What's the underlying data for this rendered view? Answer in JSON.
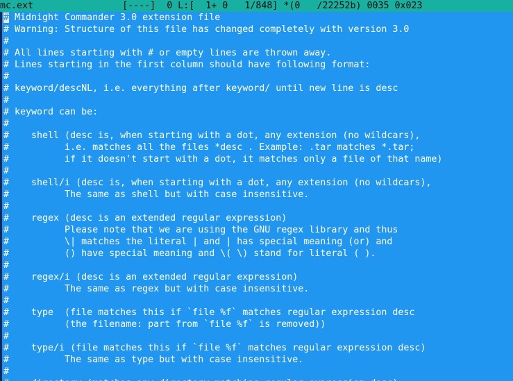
{
  "status": {
    "filename": "mc.ext",
    "flags": "[----]",
    "col": "0",
    "line_label": "L:[",
    "line_pos": "1+ 0",
    "line_count": "1/848]",
    "char_info": "*(0   /22252b)",
    "char_code": "0035 0x023"
  },
  "editor": {
    "cursor_char": "#",
    "first_line_rest": " Midnight Commander 3.0 extension file",
    "lines": [
      "# Warning: Structure of this file has changed completely with version 3.0",
      "#",
      "# All lines starting with # or empty lines are thrown away.",
      "# Lines starting in the first column should have following format:",
      "#",
      "# keyword/descNL, i.e. everything after keyword/ until new line is desc",
      "#",
      "# keyword can be:",
      "#",
      "#    shell (desc is, when starting with a dot, any extension (no wildcars),",
      "#          i.e. matches all the files *desc . Example: .tar matches *.tar;",
      "#          if it doesn't start with a dot, it matches only a file of that name)",
      "#",
      "#    shell/i (desc is, when starting with a dot, any extension (no wildcars),",
      "#          The same as shell but with case insensitive.",
      "#",
      "#    regex (desc is an extended regular expression)",
      "#          Please note that we are using the GNU regex library and thus",
      "#          \\| matches the literal | and | has special meaning (or) and",
      "#          () have special meaning and \\( \\) stand for literal ( ).",
      "#",
      "#    regex/i (desc is an extended regular expression)",
      "#          The same as regex but with case insensitive.",
      "#",
      "#    type  (file matches this if `file %f` matches regular expression desc",
      "#          (the filename: part from `file %f` is removed))",
      "#",
      "#    type/i (file matches this if `file %f` matches regular expression desc)",
      "#          The same as type but with case insensitive.",
      "#",
      "#    directory (matches any directory matching regular expression desc)"
    ]
  }
}
